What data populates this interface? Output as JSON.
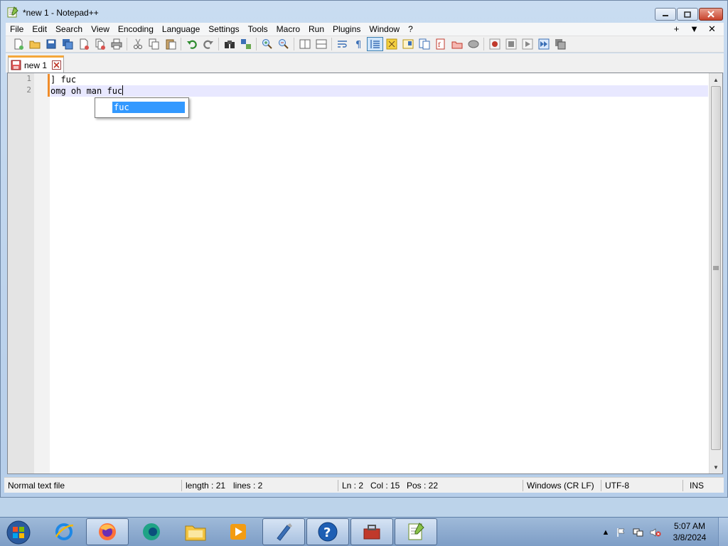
{
  "window": {
    "title": "*new 1 - Notepad++",
    "controls": {
      "minimize": "minimize",
      "maximize": "maximize",
      "close": "close"
    }
  },
  "menubar": {
    "items": [
      "File",
      "Edit",
      "Search",
      "View",
      "Encoding",
      "Language",
      "Settings",
      "Tools",
      "Macro",
      "Run",
      "Plugins",
      "Window",
      "?"
    ],
    "right": [
      "+",
      "▼",
      "✕"
    ]
  },
  "tabs": [
    {
      "label": "new 1",
      "modified": true,
      "active": true
    }
  ],
  "editor": {
    "line_numbers": [
      "1",
      "2"
    ],
    "lines": [
      "] fuc",
      "omg oh man fuc"
    ],
    "current_line": 2,
    "autocomplete": {
      "items": [
        "fuc"
      ],
      "selected": "fuc"
    }
  },
  "statusbar": {
    "file_type": "Normal text file",
    "length": "length : 21",
    "lines": "lines : 2",
    "ln": "Ln : 2",
    "col": "Col : 15",
    "pos": "Pos : 22",
    "eol": "Windows (CR LF)",
    "encoding": "UTF-8",
    "mode": "INS"
  },
  "taskbar": {
    "apps": [
      "internet-explorer",
      "firefox",
      "edge",
      "file-explorer",
      "media-player",
      "script-tool",
      "help",
      "toolbox",
      "notepad-plus-plus"
    ],
    "clock_time": "5:07 AM",
    "clock_date": "3/8/2024"
  },
  "colors": {
    "accent_tab": "#f4a73a",
    "current_line": "#e8e8ff",
    "autocomplete_selection": "#3399ff",
    "change_marker": "#f08c2a"
  }
}
